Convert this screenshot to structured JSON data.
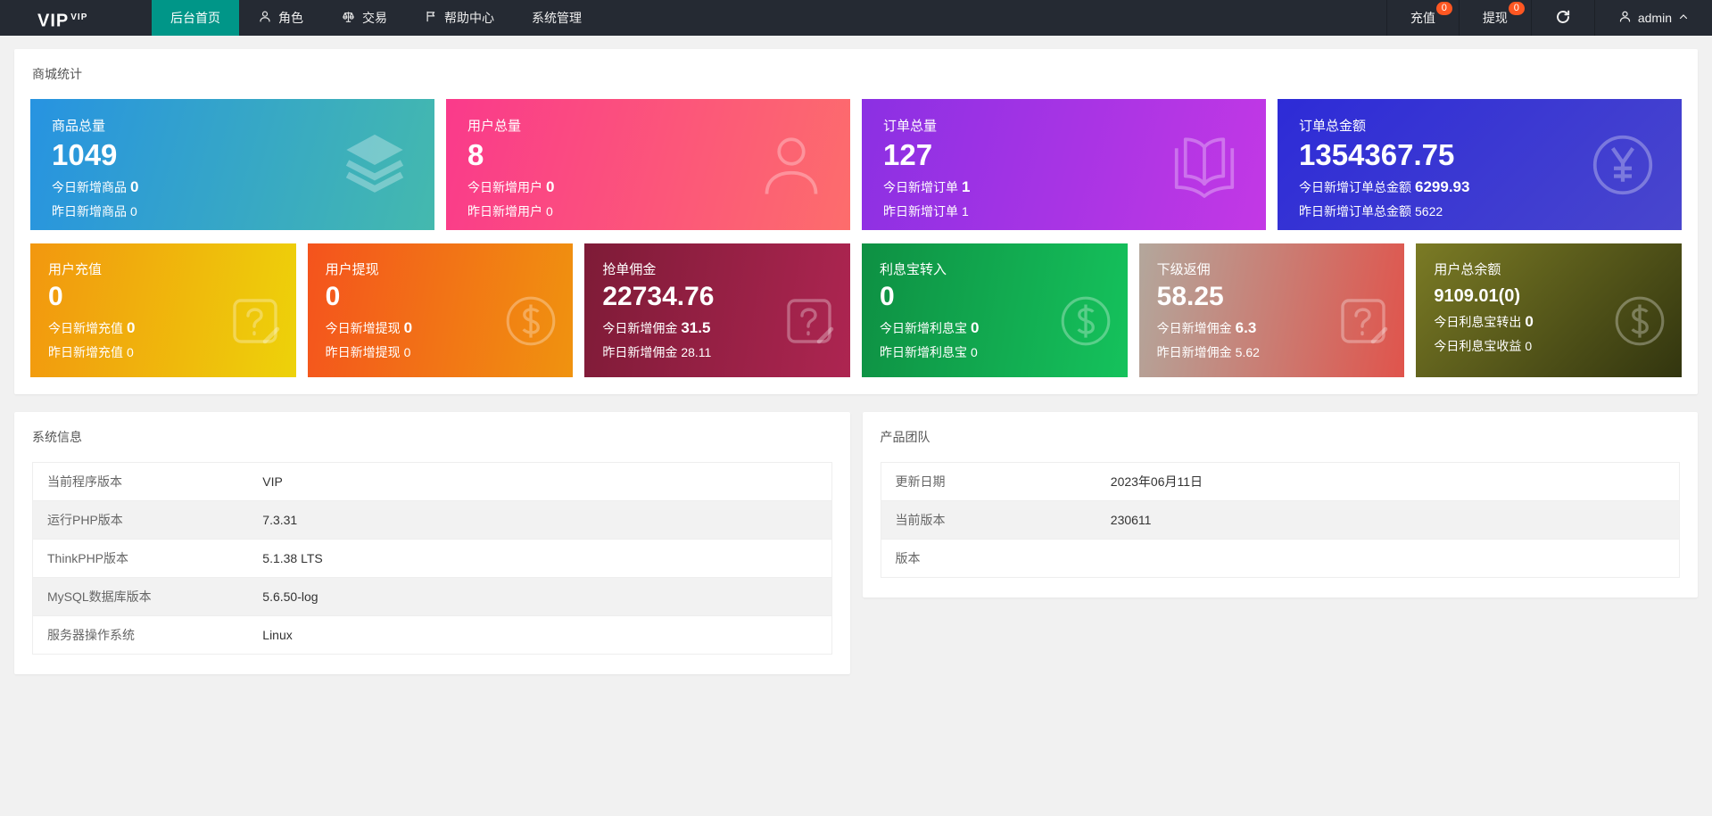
{
  "colors": {
    "nav_bg": "#252a33",
    "accent": "#009688",
    "badge": "#ff5722",
    "link": "#1e9fff"
  },
  "navbar": {
    "logo": "VIP",
    "logo_sup": "VIP",
    "menu": [
      {
        "label": "后台首页",
        "icon": "",
        "active": true
      },
      {
        "label": "角色",
        "icon": "user",
        "active": false
      },
      {
        "label": "交易",
        "icon": "scales",
        "active": false
      },
      {
        "label": "帮助中心",
        "icon": "flag",
        "active": false
      },
      {
        "label": "系统管理",
        "icon": "",
        "active": false
      }
    ],
    "recharge": {
      "label": "充值",
      "badge": "0"
    },
    "withdraw": {
      "label": "提现",
      "badge": "0"
    },
    "username": "admin"
  },
  "stats_panel": {
    "title": "商城统计",
    "big_cards": [
      {
        "label": "商品总量",
        "value": "1049",
        "line1_label": "今日新增商品",
        "line1_value": "0",
        "line2_label": "昨日新增商品",
        "line2_value": "0",
        "icon": "layers",
        "bg": "linear-gradient(105deg,#2793e1,#44b9ae)"
      },
      {
        "label": "用户总量",
        "value": "8",
        "line1_label": "今日新增用户",
        "line1_value": "0",
        "line2_label": "昨日新增用户",
        "line2_value": "0",
        "icon": "person",
        "bg": "linear-gradient(105deg,#fa3a8b,#fd6d6c)"
      },
      {
        "label": "订单总量",
        "value": "127",
        "line1_label": "今日新增订单",
        "line1_value": "1",
        "line2_label": "昨日新增订单",
        "line2_value": "1",
        "icon": "book",
        "bg": "linear-gradient(105deg,#8b30e3,#c338e5)"
      },
      {
        "label": "订单总金额",
        "value": "1354367.75",
        "line1_label": "今日新增订单总金额",
        "line1_value": "6299.93",
        "line2_label": "昨日新增订单总金额",
        "line2_value": "5622",
        "icon": "yen",
        "bg": "linear-gradient(135deg,#2d2bd7,#4946cd)"
      }
    ],
    "small_cards": [
      {
        "label": "用户充值",
        "value": "0",
        "small_value": false,
        "line1_label": "今日新增充值",
        "line1_value": "0",
        "line2_label": "昨日新增充值",
        "line2_value": "0",
        "icon": "edit",
        "bg": "linear-gradient(100deg,#f2970f,#edd20a)"
      },
      {
        "label": "用户提现",
        "value": "0",
        "small_value": false,
        "line1_label": "今日新增提现",
        "line1_value": "0",
        "line2_label": "昨日新增提现",
        "line2_value": "0",
        "icon": "dollar",
        "bg": "linear-gradient(100deg,#f4531d,#f0930f)"
      },
      {
        "label": "抢单佣金",
        "value": "22734.76",
        "small_value": false,
        "line1_label": "今日新增佣金",
        "line1_value": "31.5",
        "line2_label": "昨日新增佣金",
        "line2_value": "28.11",
        "icon": "edit",
        "bg": "linear-gradient(100deg,#7e1b37,#ad2551)"
      },
      {
        "label": "利息宝转入",
        "value": "0",
        "small_value": false,
        "line1_label": "今日新增利息宝",
        "line1_value": "0",
        "line2_label": "昨日新增利息宝",
        "line2_value": "0",
        "icon": "dollar",
        "bg": "linear-gradient(100deg,#0e9043,#15c25c)"
      },
      {
        "label": "下级返佣",
        "value": "58.25",
        "small_value": false,
        "line1_label": "今日新增佣金",
        "line1_value": "6.3",
        "line2_label": "昨日新增佣金",
        "line2_value": "5.62",
        "icon": "edit",
        "bg": "linear-gradient(100deg,#b3a79c,#e0544c)"
      },
      {
        "label": "用户总余额",
        "value": "9109.01(0)",
        "small_value": true,
        "line1_label": "今日利息宝转出",
        "line1_value": "0",
        "line2_label": "今日利息宝收益",
        "line2_value": "0",
        "icon": "dollar",
        "bg": "linear-gradient(135deg,#7b7b25,#32350f)"
      }
    ]
  },
  "system_panel": {
    "title": "系统信息",
    "rows": [
      {
        "label": "当前程序版本",
        "value": "VIP",
        "link": false
      },
      {
        "label": "运行PHP版本",
        "value": "7.3.31",
        "link": false
      },
      {
        "label": "ThinkPHP版本",
        "value": "5.1.38 LTS",
        "link": false
      },
      {
        "label": "MySQL数据库版本",
        "value": "5.6.50-log",
        "link": false
      },
      {
        "label": "服务器操作系统",
        "value": "Linux",
        "link": false
      }
    ]
  },
  "team_panel": {
    "title": "产品团队",
    "rows": [
      {
        "label": "更新日期",
        "value": "2023年06月11日",
        "link": true
      },
      {
        "label": "当前版本",
        "value": "230611",
        "link": true
      },
      {
        "label": "版本",
        "value": "",
        "link": false
      }
    ]
  }
}
